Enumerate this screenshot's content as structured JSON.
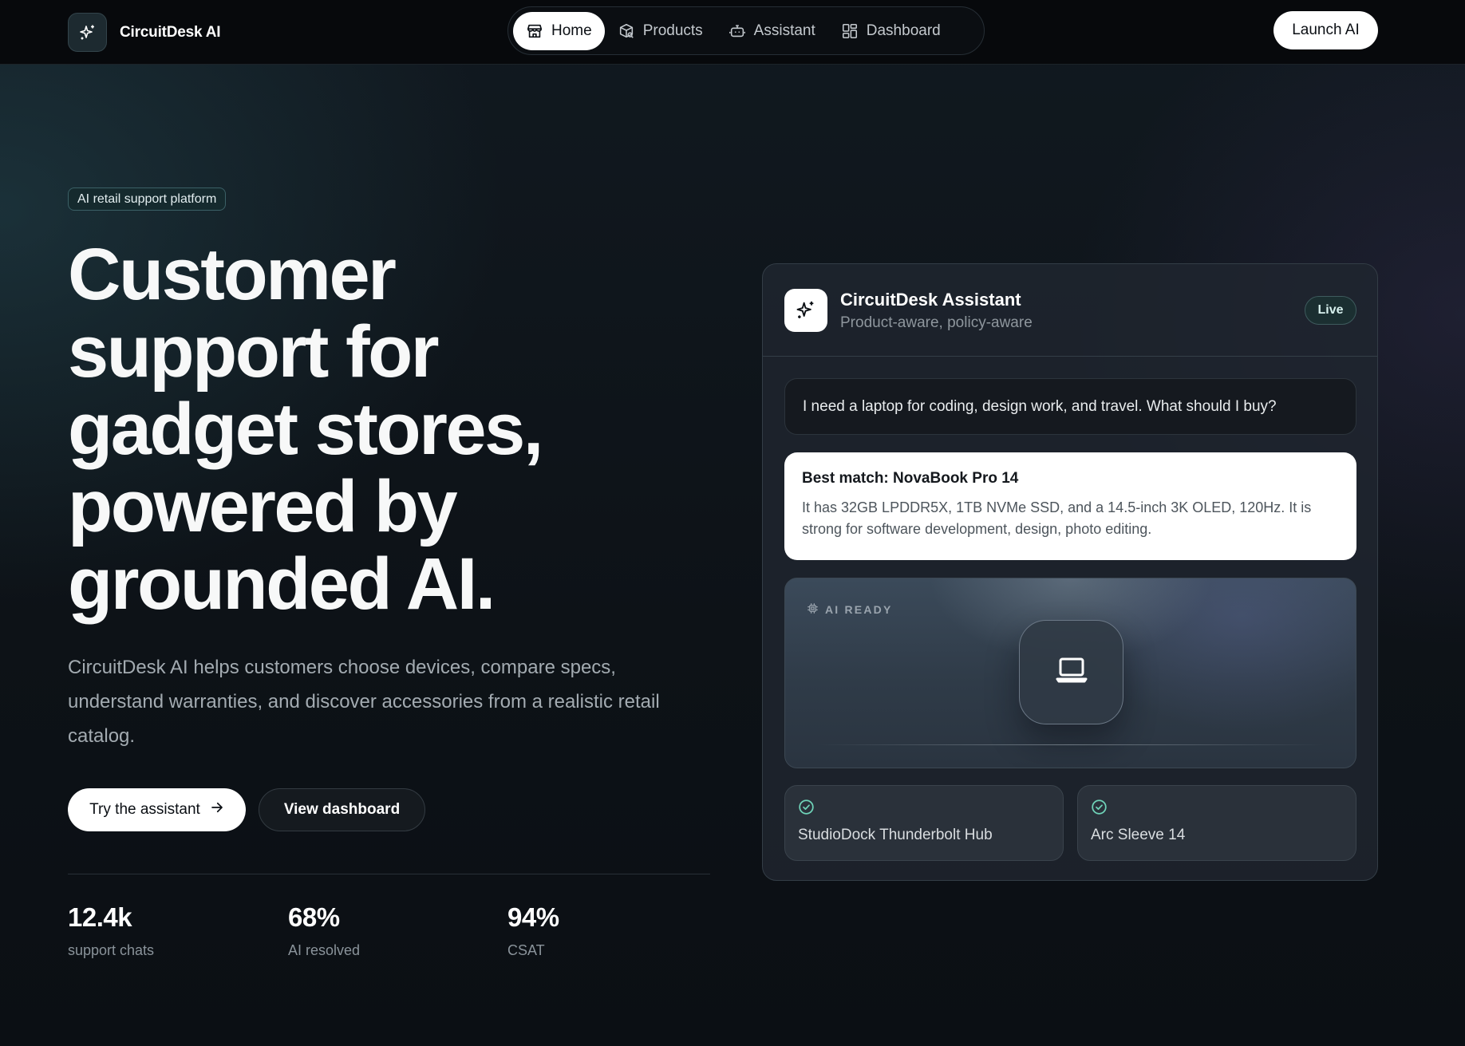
{
  "nav": {
    "brand": "CircuitDesk AI",
    "tabs": [
      {
        "label": "Home",
        "icon": "store-icon",
        "active": true
      },
      {
        "label": "Products",
        "icon": "package-icon",
        "active": false
      },
      {
        "label": "Assistant",
        "icon": "bot-icon",
        "active": false
      },
      {
        "label": "Dashboard",
        "icon": "dashboard-icon",
        "active": false
      }
    ],
    "cta": "Launch AI"
  },
  "hero": {
    "tag": "AI retail support platform",
    "title_lines": [
      "Customer",
      "support for",
      "gadget stores,",
      "powered by",
      "grounded AI."
    ],
    "description": "CircuitDesk AI helps customers choose devices, compare specs, understand warranties, and discover accessories from a realistic retail catalog.",
    "primary_button": "Try the assistant",
    "secondary_button": "View dashboard",
    "stats": [
      {
        "value": "12.4k",
        "label": "support chats"
      },
      {
        "value": "68%",
        "label": "AI resolved"
      },
      {
        "value": "94%",
        "label": "CSAT"
      }
    ]
  },
  "assistant": {
    "name": "CircuitDesk Assistant",
    "subtitle": "Product-aware, policy-aware",
    "status": "Live",
    "user_message": "I need a laptop for coding, design work, and travel. What should I buy?",
    "reply_title": "Best match: NovaBook Pro 14",
    "reply_body": "It has 32GB LPDDR5X, 1TB NVMe SSD, and a 14.5-inch 3K OLED, 120Hz. It is strong for software development, design, photo editing.",
    "visual_label": "AI READY",
    "accessories": [
      "StudioDock Thunderbolt Hub",
      "Arc Sleeve 14"
    ]
  },
  "colors": {
    "background": "#0d1217",
    "accent_teal": "#6fd3b8",
    "surface": "#20262f"
  }
}
